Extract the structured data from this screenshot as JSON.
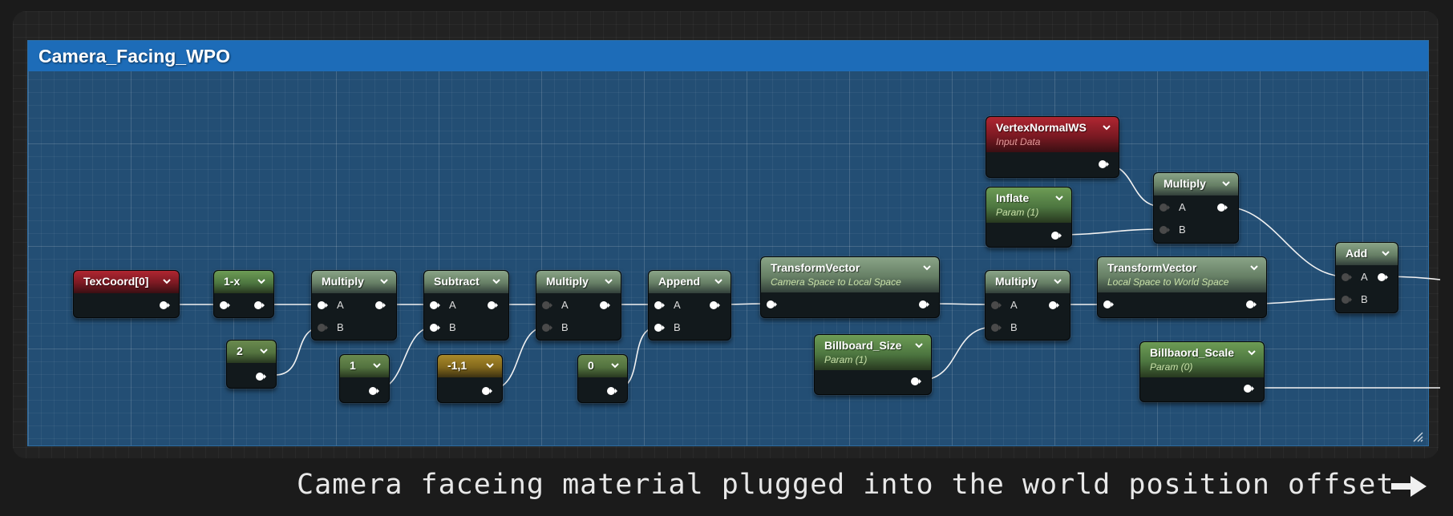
{
  "comment": {
    "title": "Camera_Facing_WPO"
  },
  "caption": {
    "text": "Camera faceing material plugged into the world position offset",
    "icon": "right-arrow-icon"
  },
  "colors": {
    "input_data": "#b02631",
    "param": "#6d9c55",
    "math": "#8aa487",
    "constant": "#a8892a",
    "comment": "#1d6cb8",
    "background": "#1b1b1b"
  },
  "nodes": {
    "texcoord": {
      "title": "TexCoord[0]"
    },
    "one_minus": {
      "title": "1-x"
    },
    "const_2": {
      "title": "2"
    },
    "multiply_1": {
      "title": "Multiply",
      "pin_a": "A",
      "pin_b": "B"
    },
    "const_1": {
      "title": "1"
    },
    "subtract": {
      "title": "Subtract",
      "pin_a": "A",
      "pin_b": "B"
    },
    "const_neg1_1": {
      "title": "-1,1"
    },
    "multiply_2": {
      "title": "Multiply",
      "pin_a": "A",
      "pin_b": "B"
    },
    "const_0": {
      "title": "0"
    },
    "append": {
      "title": "Append",
      "pin_a": "A",
      "pin_b": "B"
    },
    "transform_cam_local": {
      "title": "TransformVector",
      "subtitle": "Camera Space to Local Space"
    },
    "billboard_size": {
      "title": "Billboard_Size",
      "subtitle": "Param (1)"
    },
    "multiply_3": {
      "title": "Multiply",
      "pin_a": "A",
      "pin_b": "B"
    },
    "transform_local_world": {
      "title": "TransformVector",
      "subtitle": "Local Space to World Space"
    },
    "billbaord_scale": {
      "title": "Billbaord_Scale",
      "subtitle": "Param (0)"
    },
    "vertex_normal": {
      "title": "VertexNormalWS",
      "subtitle": "Input Data"
    },
    "inflate": {
      "title": "Inflate",
      "subtitle": "Param (1)"
    },
    "multiply_4": {
      "title": "Multiply",
      "pin_a": "A",
      "pin_b": "B"
    },
    "add": {
      "title": "Add",
      "pin_a": "A",
      "pin_b": "B"
    }
  }
}
